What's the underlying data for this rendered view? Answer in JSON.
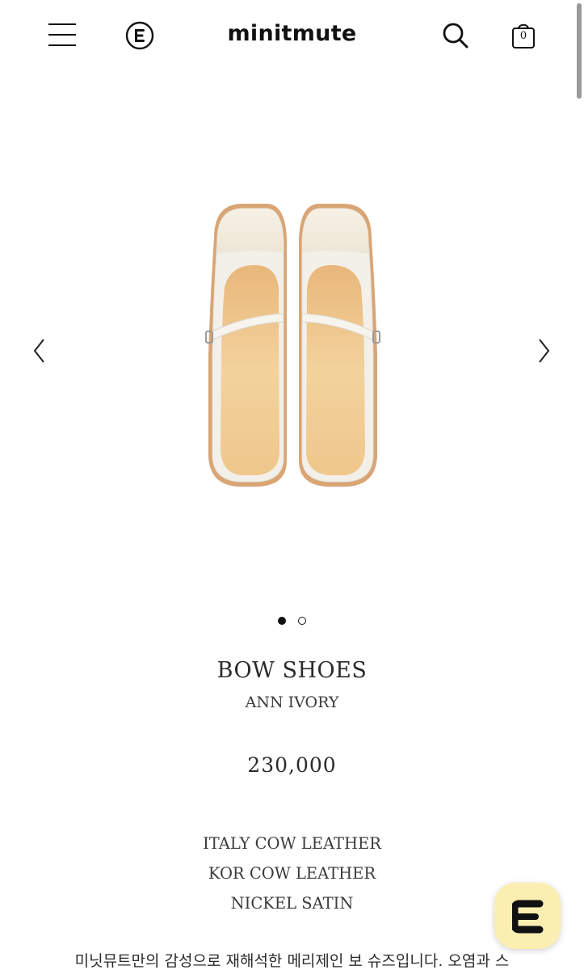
{
  "header": {
    "menu_icon": "hamburger-menu-icon",
    "brand_icon": "brand-circle-e-icon",
    "logo": "minitmute",
    "search_icon": "search-icon",
    "cart_icon": "shopping-bag-icon",
    "cart_count": "0"
  },
  "gallery": {
    "prev_icon": "chevron-left-icon",
    "next_icon": "chevron-right-icon",
    "image_alt": "BOW SHOES",
    "total_slides": 2,
    "active_slide": 1
  },
  "product": {
    "name": "BOW SHOES",
    "color": "ANN IVORY",
    "price": "230,000",
    "materials": [
      "ITALY COW LEATHER",
      "KOR COW LEATHER",
      "NICKEL SATIN"
    ],
    "description": "미닛뮤트만의 감성으로 재해석한 메리제인 보 슈즈입니다. 오염과 스"
  },
  "chat_button": {
    "icon": "chat-e-icon",
    "color": "#fbeeb1"
  }
}
